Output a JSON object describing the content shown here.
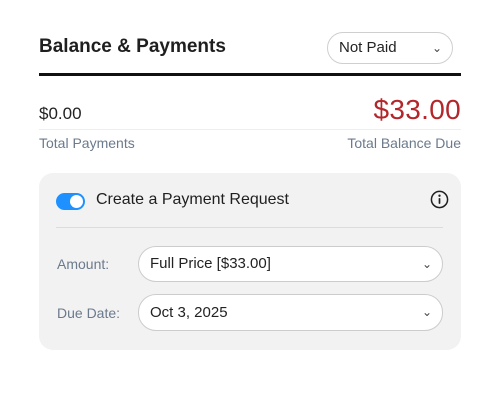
{
  "header": {
    "title": "Balance & Payments",
    "status_value": "Not Paid"
  },
  "summary": {
    "total_payments_value": "$0.00",
    "total_payments_label": "Total Payments",
    "total_balance_value": "$33.00",
    "total_balance_label": "Total Balance Due"
  },
  "payment_request": {
    "toggle_on": true,
    "toggle_label": "Create a Payment Request",
    "amount_label": "Amount:",
    "amount_value": "Full Price [$33.00]",
    "due_date_label": "Due Date:",
    "due_date_value": "Oct 3, 2025"
  },
  "colors": {
    "accent": "#1e90ff",
    "balance_due": "#b3262b",
    "muted_label": "#6b7a8c",
    "card_bg": "#f2f2f2"
  },
  "icons": {
    "select_chevron": "chevron-down-icon",
    "info": "info-icon"
  }
}
